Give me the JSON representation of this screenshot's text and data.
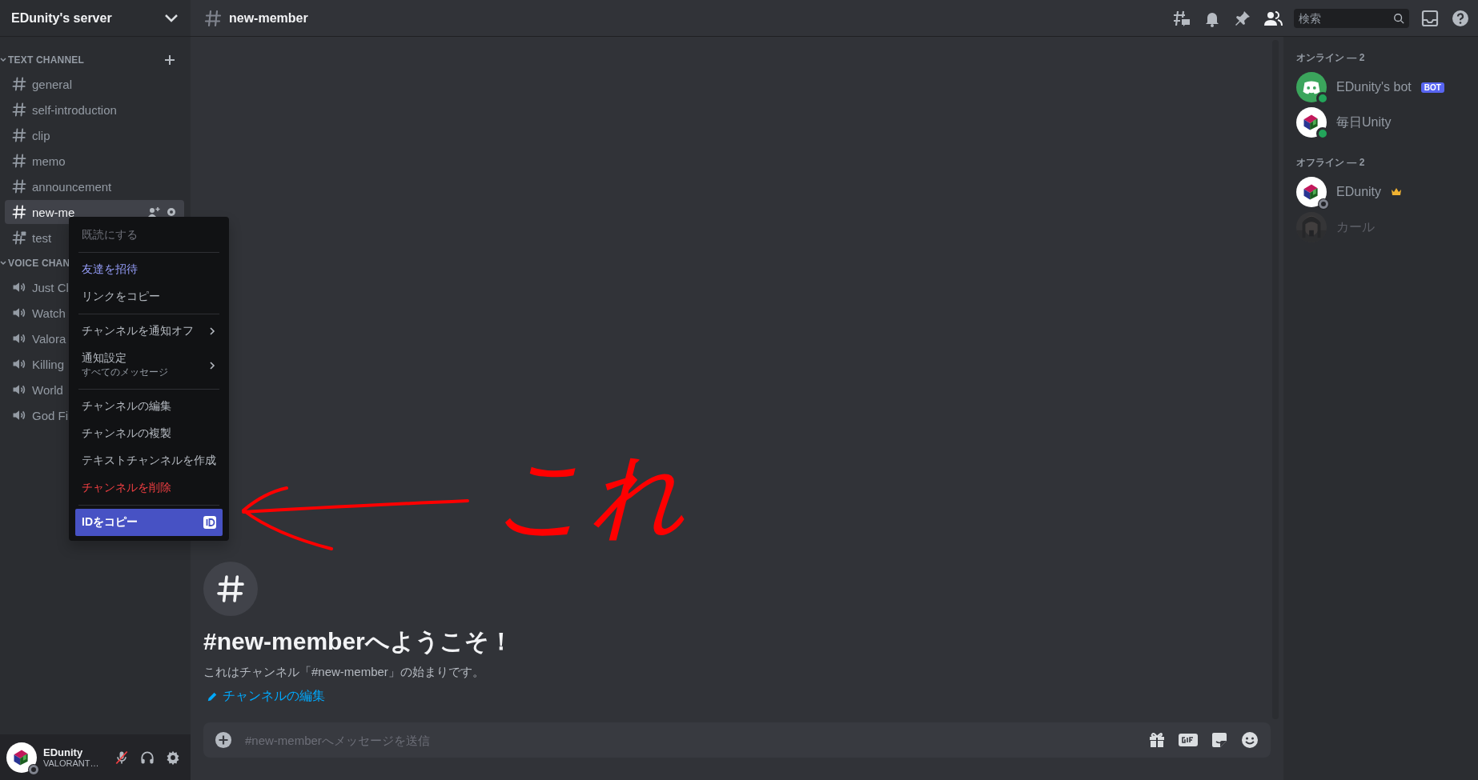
{
  "server": {
    "name": "EDunity's server"
  },
  "categories": [
    {
      "name": "TEXT CHANNEL",
      "can_add": true,
      "channels": [
        {
          "name": "general",
          "kind": "text",
          "selected": false
        },
        {
          "name": "self-introduction",
          "kind": "text",
          "selected": false
        },
        {
          "name": "clip",
          "kind": "text",
          "selected": false
        },
        {
          "name": "memo",
          "kind": "text",
          "selected": false
        },
        {
          "name": "announcement",
          "kind": "text",
          "selected": false
        },
        {
          "name": "new-me",
          "kind": "text",
          "selected": true
        },
        {
          "name": "test",
          "kind": "locked",
          "selected": false
        }
      ]
    },
    {
      "name": "VOICE CHAN",
      "can_add": false,
      "channels": [
        {
          "name": "Just Cl",
          "kind": "voice",
          "selected": false
        },
        {
          "name": "Watch",
          "kind": "voice",
          "selected": false
        },
        {
          "name": "Valora",
          "kind": "voice",
          "selected": false
        },
        {
          "name": "Killing",
          "kind": "voice",
          "selected": false
        },
        {
          "name": "World",
          "kind": "voice",
          "selected": false
        },
        {
          "name": "God Fi",
          "kind": "voice",
          "selected": false
        }
      ]
    }
  ],
  "user_panel": {
    "name": "EDunity",
    "activity": "VALORANT…",
    "mic_muted": true
  },
  "header": {
    "channel": "new-member",
    "search_placeholder": "検索"
  },
  "context_menu": {
    "groups": [
      [
        {
          "label": "既読にする",
          "kind": "muted",
          "selected": false
        }
      ],
      [
        {
          "label": "友達を招待",
          "kind": "accent",
          "selected": false
        },
        {
          "label": "リンクをコピー",
          "kind": "normal",
          "selected": false
        }
      ],
      [
        {
          "label": "チャンネルを通知オフ",
          "kind": "normal",
          "submenu": true,
          "selected": false
        },
        {
          "label": "通知設定",
          "sublabel": "すべてのメッセージ",
          "kind": "normal",
          "submenu": true,
          "selected": false
        }
      ],
      [
        {
          "label": "チャンネルの編集",
          "kind": "normal",
          "selected": false
        },
        {
          "label": "チャンネルの複製",
          "kind": "normal",
          "selected": false
        },
        {
          "label": "テキストチャンネルを作成",
          "kind": "normal",
          "selected": false
        },
        {
          "label": "チャンネルを削除",
          "kind": "danger",
          "selected": false
        }
      ],
      [
        {
          "label": "IDをコピー",
          "kind": "normal",
          "id_badge": true,
          "selected": true
        }
      ]
    ]
  },
  "welcome": {
    "title": "#new-memberへようこそ！",
    "description": "これはチャンネル「#new-member」の始まりです。",
    "edit_link": "チャンネルの編集"
  },
  "composer": {
    "placeholder": "#new-memberへメッセージを送信"
  },
  "annotation": {
    "label": "これ"
  },
  "members": [
    {
      "title": "オンライン — 2",
      "members": [
        {
          "name": "EDunity's bot",
          "kind": "bot",
          "online": true,
          "badge": "BOT",
          "owner": false,
          "dimmed": false
        },
        {
          "name": "毎日Unity",
          "kind": "cube",
          "online": true,
          "owner": false,
          "dimmed": false
        }
      ]
    },
    {
      "title": "オフライン — 2",
      "members": [
        {
          "name": "EDunity",
          "kind": "cube",
          "online": false,
          "owner": true,
          "dimmed": false
        },
        {
          "name": "カール",
          "online": false,
          "owner": false,
          "dimmed": true
        }
      ]
    }
  ]
}
